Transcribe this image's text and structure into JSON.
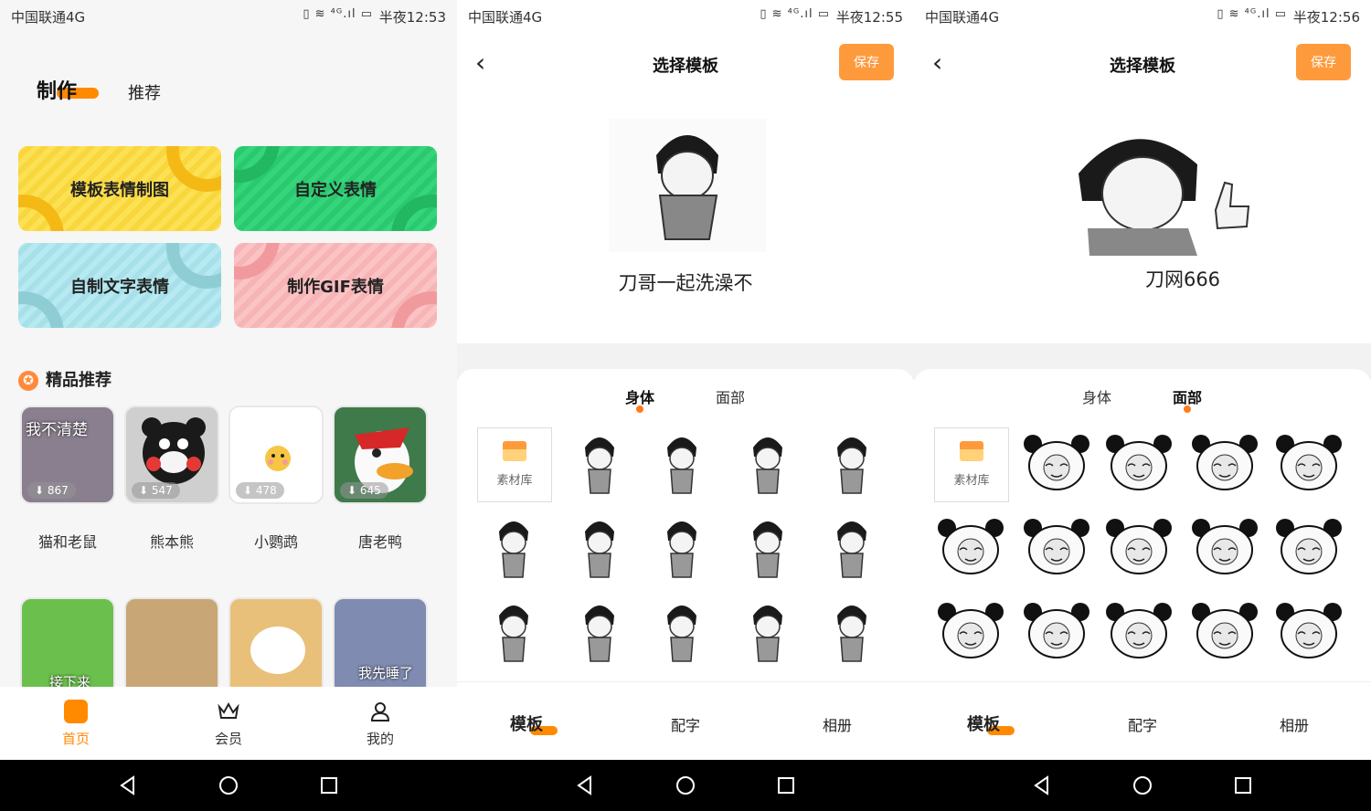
{
  "status": [
    {
      "carrier": "中国联通4G",
      "time": "半夜12:53"
    },
    {
      "carrier": "中国联通4G",
      "time": "半夜12:55"
    },
    {
      "carrier": "中国联通4G",
      "time": "半夜12:56"
    }
  ],
  "home": {
    "tabs": [
      "制作",
      "推荐"
    ],
    "cards": [
      "模板表情制图",
      "自定义表情",
      "自制文字表情",
      "制作GIF表情"
    ],
    "section_title": "精品推荐",
    "tiles": [
      {
        "name": "猫和老鼠",
        "count": "867",
        "caption": "我不清楚"
      },
      {
        "name": "熊本熊",
        "count": "547",
        "caption": ""
      },
      {
        "name": "小鹦鹉",
        "count": "478",
        "caption": ""
      },
      {
        "name": "唐老鸭",
        "count": "645",
        "caption": ""
      }
    ],
    "row2_captions": [
      "接下来",
      "",
      "",
      "我先睡了"
    ],
    "nav": [
      "首页",
      "会员",
      "我的"
    ]
  },
  "editor": {
    "title": "选择模板",
    "save": "保存",
    "categories": [
      "身体",
      "面部"
    ],
    "library": "素材库",
    "bottom_tabs": [
      "模板",
      "配字",
      "相册"
    ],
    "screen2_caption": "刀哥一起洗澡不",
    "screen3_caption": "刀网666"
  },
  "colors": {
    "accent": "#ff8a00",
    "save": "#ff9a3c"
  }
}
